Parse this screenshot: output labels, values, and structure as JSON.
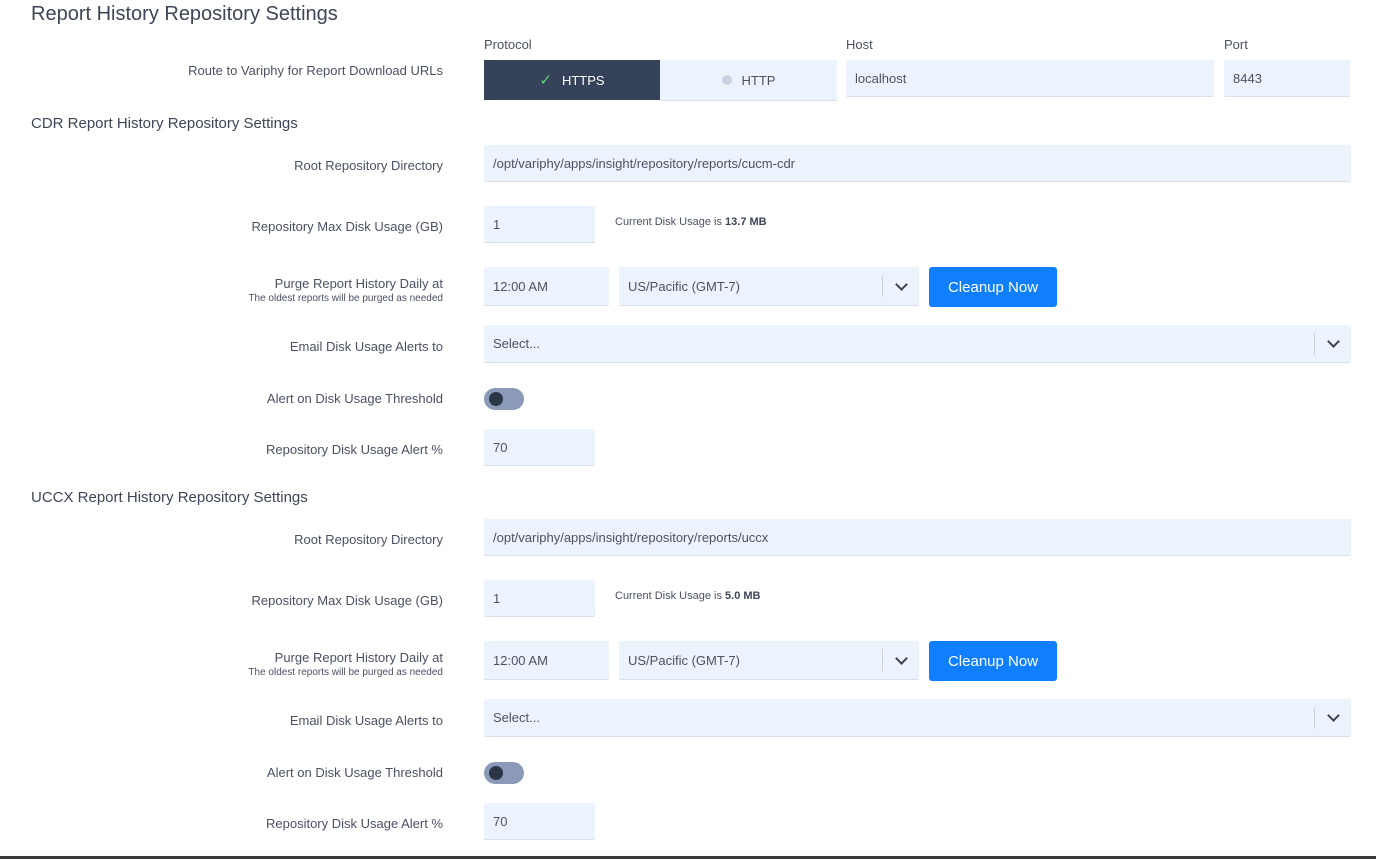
{
  "page": {
    "title": "Report History Repository Settings"
  },
  "route": {
    "label": "Route to Variphy for Report Download URLs",
    "protocol_header": "Protocol",
    "host_header": "Host",
    "port_header": "Port",
    "protocol_options": [
      "HTTPS",
      "HTTP"
    ],
    "protocol_selected": "HTTPS",
    "host_value": "localhost",
    "port_value": "8443"
  },
  "labels": {
    "root_dir": "Root Repository Directory",
    "max_disk": "Repository Max Disk Usage (GB)",
    "purge": "Purge Report History Daily at",
    "purge_note": "The oldest reports will be purged as needed",
    "email_alerts": "Email Disk Usage Alerts to",
    "alert_threshold": "Alert on Disk Usage Threshold",
    "alert_percent": "Repository Disk Usage Alert %",
    "current_usage_prefix": "Current Disk Usage is",
    "cleanup_button": "Cleanup Now",
    "email_placeholder": "Select..."
  },
  "cdr": {
    "title": "CDR Report History Repository Settings",
    "root_dir": "/opt/variphy/apps/insight/repository/reports/cucm-cdr",
    "max_disk": "1",
    "current_usage": "13.7 MB",
    "purge_time": "12:00 AM",
    "timezone": "US/Pacific (GMT-7)",
    "alert_enabled": false,
    "alert_percent": "70"
  },
  "uccx": {
    "title": "UCCX Report History Repository Settings",
    "root_dir": "/opt/variphy/apps/insight/repository/reports/uccx",
    "max_disk": "1",
    "current_usage": "5.0 MB",
    "purge_time": "12:00 AM",
    "timezone": "US/Pacific (GMT-7)",
    "alert_enabled": false,
    "alert_percent": "70"
  },
  "colors": {
    "accent": "#0f7fff",
    "selected_segment": "#36425a",
    "field_bg": "#edf3fd",
    "toggle_off": "#8a9ab8",
    "check": "#5fd37a"
  },
  "icons": {
    "check": "check-icon",
    "radio": "radio-dot-icon",
    "dropdown": "chevron-down-icon"
  }
}
